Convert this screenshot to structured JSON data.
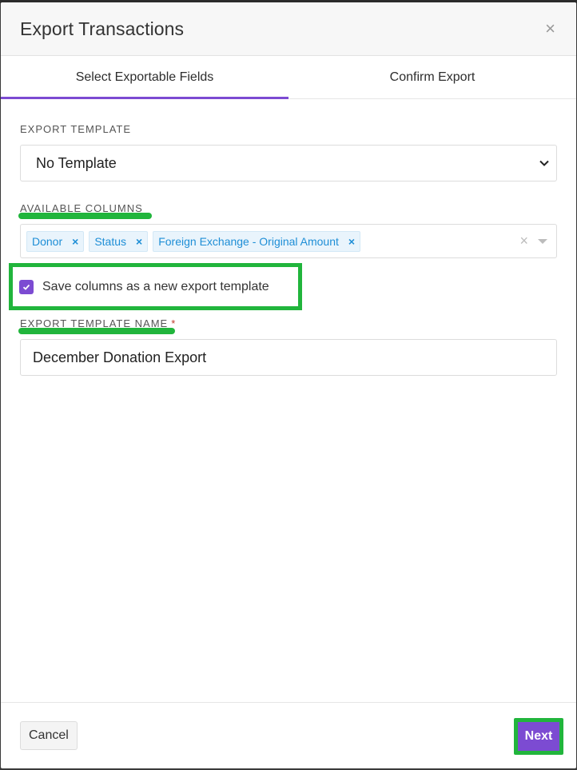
{
  "modal": {
    "title": "Export Transactions",
    "close_icon": "close-icon"
  },
  "tabs": [
    {
      "label": "Select Exportable Fields",
      "active": true
    },
    {
      "label": "Confirm Export",
      "active": false
    }
  ],
  "export_template": {
    "label": "EXPORT TEMPLATE",
    "selected": "No Template"
  },
  "available_columns": {
    "label": "AVAILABLE COLUMNS",
    "chips": [
      "Donor",
      "Status",
      "Foreign Exchange - Original Amount"
    ]
  },
  "save_template": {
    "label": "Save columns as a new export template",
    "checked": true
  },
  "template_name": {
    "label": "EXPORT TEMPLATE NAME",
    "required_mark": "*",
    "value": "December Donation Export"
  },
  "footer": {
    "cancel_label": "Cancel",
    "next_label": "Next"
  },
  "colors": {
    "accent": "#7c4bd2",
    "highlight": "#21b53c",
    "chip_text": "#1e8ed6"
  }
}
